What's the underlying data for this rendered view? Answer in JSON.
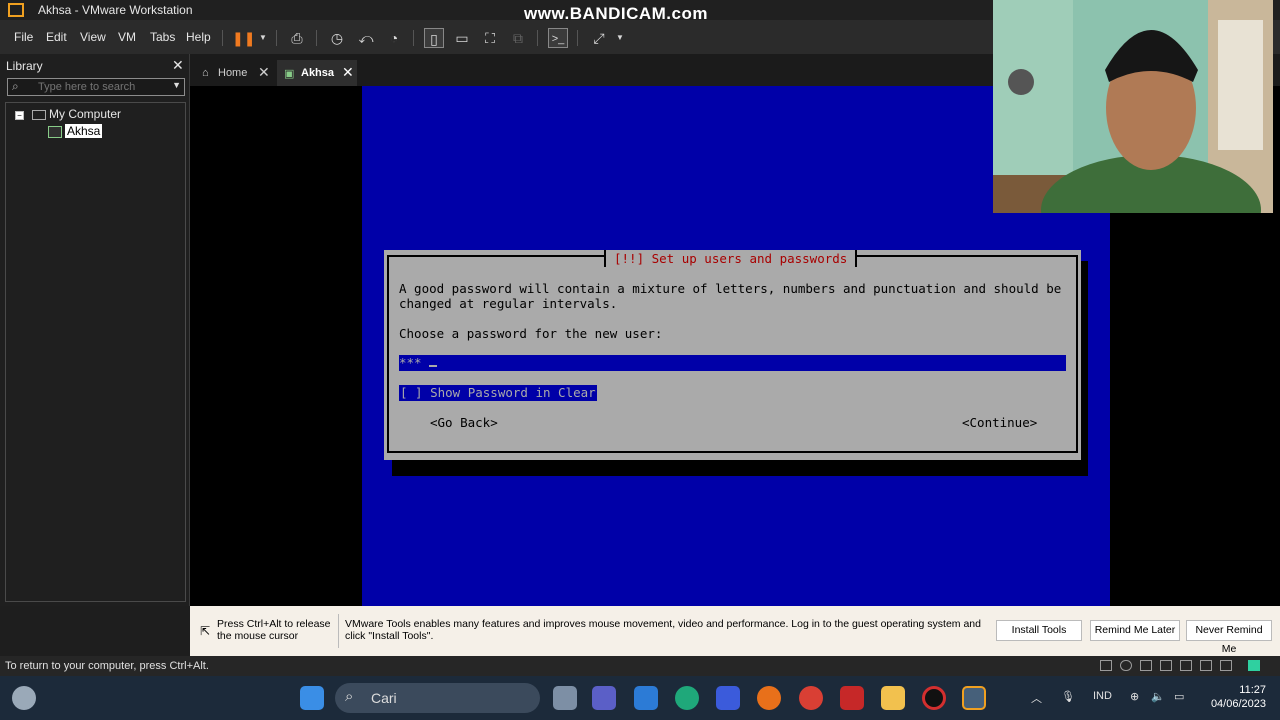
{
  "window": {
    "title": "Akhsa - VMware Workstation"
  },
  "watermark": "www.BANDICAM.com",
  "menu": [
    "File",
    "Edit",
    "View",
    "VM",
    "Tabs",
    "Help"
  ],
  "library": {
    "title": "Library",
    "search_placeholder": "Type here to search",
    "tree": {
      "root": "My Computer",
      "child": "Akhsa"
    }
  },
  "tabs": [
    {
      "label": "Home",
      "active": false
    },
    {
      "label": "Akhsa",
      "active": true
    }
  ],
  "installer": {
    "title": "[!!] Set up users and passwords",
    "line1": "A good password will contain a mixture of letters, numbers and punctuation and should be",
    "line2": "changed at regular intervals.",
    "prompt": "Choose a password for the new user:",
    "password_value": "***",
    "show_password": "[ ] Show Password in Clear",
    "go_back": "<Go Back>",
    "continue": "<Continue>"
  },
  "message_bar": {
    "hint": "Press Ctrl+Alt to release the mouse cursor",
    "tools_message": "VMware Tools enables many features and improves mouse movement, video and performance. Log in to the guest operating system and click \"Install Tools\".",
    "install_tools": "Install Tools",
    "remind_later": "Remind Me Later",
    "never_remind": "Never Remind Me"
  },
  "status_bar": {
    "text": "To return to your computer, press Ctrl+Alt."
  },
  "taskbar": {
    "search_label": "Cari",
    "language": "IND",
    "time": "11:27",
    "date": "04/06/2023"
  }
}
